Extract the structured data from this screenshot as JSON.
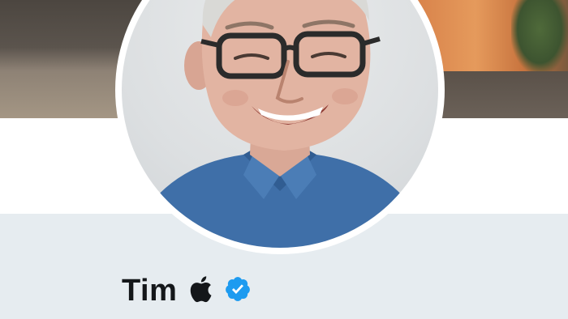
{
  "profile": {
    "name": "Tim"
  },
  "icons": {
    "emoji": "apple-logo-icon",
    "badge": "verified-badge-icon"
  },
  "colors": {
    "verified_blue": "#1d9bf0",
    "background": "#e6ecf0",
    "name_text": "#14171a"
  }
}
